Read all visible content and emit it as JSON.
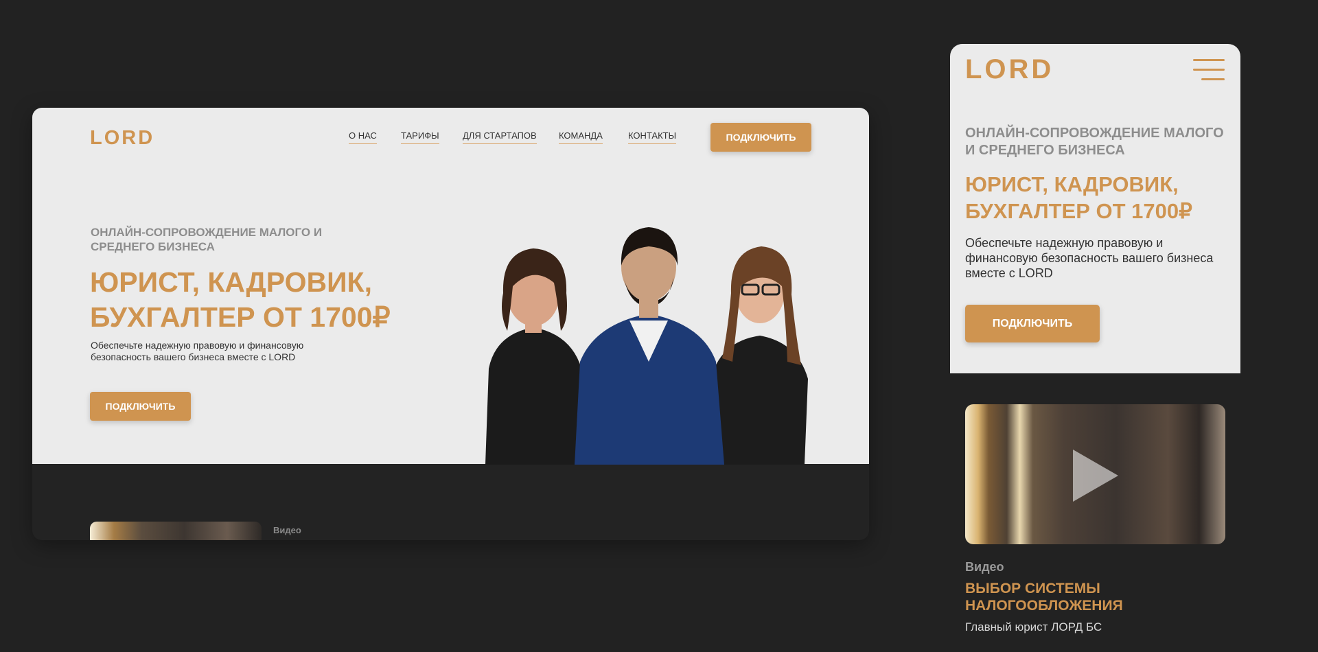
{
  "brand": {
    "logo": "LORD",
    "accent": "#cf9450",
    "background": "#222222"
  },
  "desktop": {
    "nav": [
      {
        "label": "О НАС"
      },
      {
        "label": "ТАРИФЫ"
      },
      {
        "label": "ДЛЯ СТАРТАПОВ"
      },
      {
        "label": "КОМАНДА"
      },
      {
        "label": "КОНТАКТЫ"
      }
    ],
    "cta_top": "ПОДКЛЮЧИТЬ",
    "kicker": "ОНЛАЙН-СОПРОВОЖДЕНИЕ МАЛОГО И СРЕДНЕГО БИЗНЕСА",
    "title": "ЮРИСТ, КАДРОВИК, БУХГАЛТЕР ОТ 1700₽",
    "description": "Обеспечьте надежную правовую и финансовую безопасность вашего бизнеса вместе с LORD",
    "cta": "ПОДКЛЮЧИТЬ",
    "video_label": "Видео"
  },
  "mobile": {
    "kicker": "ОНЛАЙН-СОПРОВОЖДЕНИЕ МАЛОГО И СРЕДНЕГО БИЗНЕСА",
    "title": "ЮРИСТ, КАДРОВИК, БУХГАЛТЕР ОТ 1700₽",
    "description": "Обеспечьте надежную правовую и финансовую безопасность вашего бизнеса вместе с LORD",
    "cta": "ПОДКЛЮЧИТЬ",
    "video": {
      "tag": "Видео",
      "title": "ВЫБОР СИСТЕМЫ НАЛОГООБЛОЖЕНИЯ",
      "subtitle": "Главный юрист ЛОРД БС",
      "icon": "play-icon"
    },
    "menu_icon": "hamburger-icon"
  }
}
